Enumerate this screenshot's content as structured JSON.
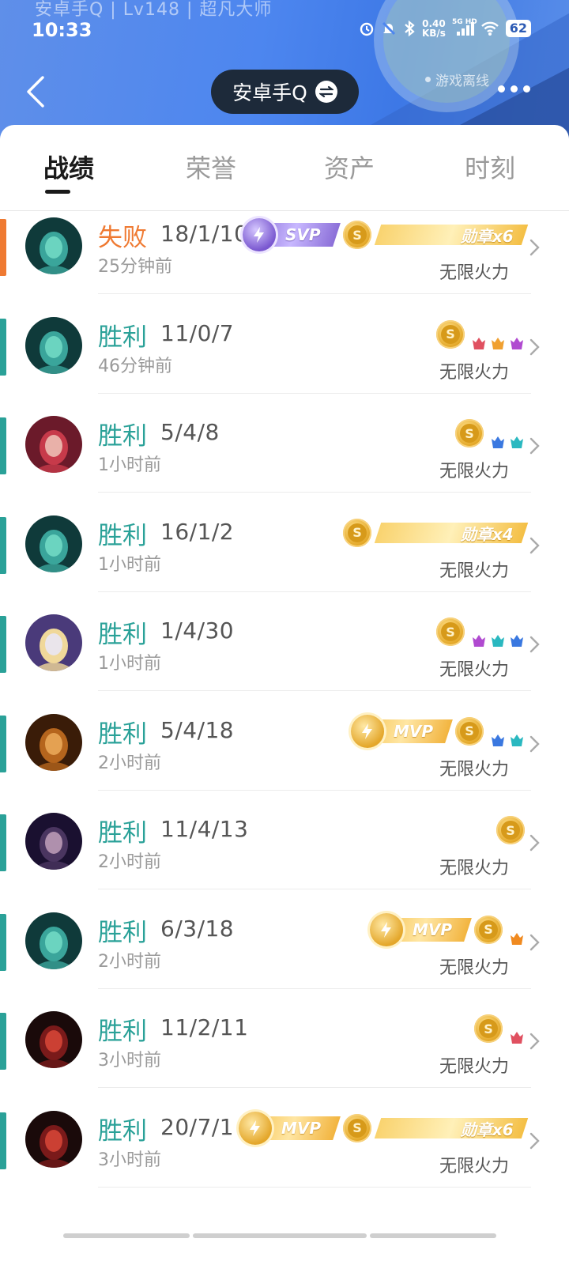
{
  "status_bar": {
    "title": "安卓手Q | Lv148 | 超凡大师",
    "time": "10:33",
    "net_speed_value": "0.40",
    "net_speed_unit": "KB/s",
    "signal_label": "5G HD",
    "battery": "62"
  },
  "header": {
    "account_name": "安卓手Q",
    "game_status": "游戏离线"
  },
  "tabs": [
    {
      "label": "战绩",
      "active": true
    },
    {
      "label": "荣誉",
      "active": false
    },
    {
      "label": "资产",
      "active": false
    },
    {
      "label": "时刻",
      "active": false
    }
  ],
  "matches": [
    {
      "result": "失败",
      "outcome": "loss",
      "kda": "18/1/10",
      "time": "25分钟前",
      "mode": "无限火力",
      "title_badge": "SVP",
      "coin": "S",
      "medal": "勋章x6",
      "avatar": "green"
    },
    {
      "result": "胜利",
      "outcome": "win",
      "kda": "11/0/7",
      "time": "46分钟前",
      "mode": "无限火力",
      "coin": "S",
      "mini": [
        "red",
        "gold",
        "purple"
      ],
      "avatar": "green"
    },
    {
      "result": "胜利",
      "outcome": "win",
      "kda": "5/4/8",
      "time": "1小时前",
      "mode": "无限火力",
      "coin": "S",
      "mini": [
        "blue",
        "teal"
      ],
      "avatar": "redhair"
    },
    {
      "result": "胜利",
      "outcome": "win",
      "kda": "16/1/2",
      "time": "1小时前",
      "mode": "无限火力",
      "coin": "S",
      "medal": "勋章x4",
      "avatar": "green"
    },
    {
      "result": "胜利",
      "outcome": "win",
      "kda": "1/4/30",
      "time": "1小时前",
      "mode": "无限火力",
      "coin": "S",
      "mini": [
        "purple",
        "teal",
        "blue"
      ],
      "avatar": "cat"
    },
    {
      "result": "胜利",
      "outcome": "win",
      "kda": "5/4/18",
      "time": "2小时前",
      "mode": "无限火力",
      "title_badge": "MVP",
      "coin": "S",
      "mini": [
        "blue",
        "teal"
      ],
      "avatar": "warrior"
    },
    {
      "result": "胜利",
      "outcome": "win",
      "kda": "11/4/13",
      "time": "2小时前",
      "mode": "无限火力",
      "coin": "S",
      "avatar": "darkhair"
    },
    {
      "result": "胜利",
      "outcome": "win",
      "kda": "6/3/18",
      "time": "2小时前",
      "mode": "无限火力",
      "title_badge": "MVP",
      "coin": "S",
      "mini": [
        "orange"
      ],
      "avatar": "green"
    },
    {
      "result": "胜利",
      "outcome": "win",
      "kda": "11/2/11",
      "time": "3小时前",
      "mode": "无限火力",
      "coin": "S",
      "mini": [
        "red"
      ],
      "avatar": "demon"
    },
    {
      "result": "胜利",
      "outcome": "win",
      "kda": "20/7/1",
      "time": "3小时前",
      "mode": "无限火力",
      "title_badge": "MVP",
      "coin": "S",
      "medal": "勋章x6",
      "avatar": "demon"
    }
  ],
  "colors": {
    "win": "#2aa198",
    "loss": "#ef7a32",
    "header": "#4d86ef"
  }
}
